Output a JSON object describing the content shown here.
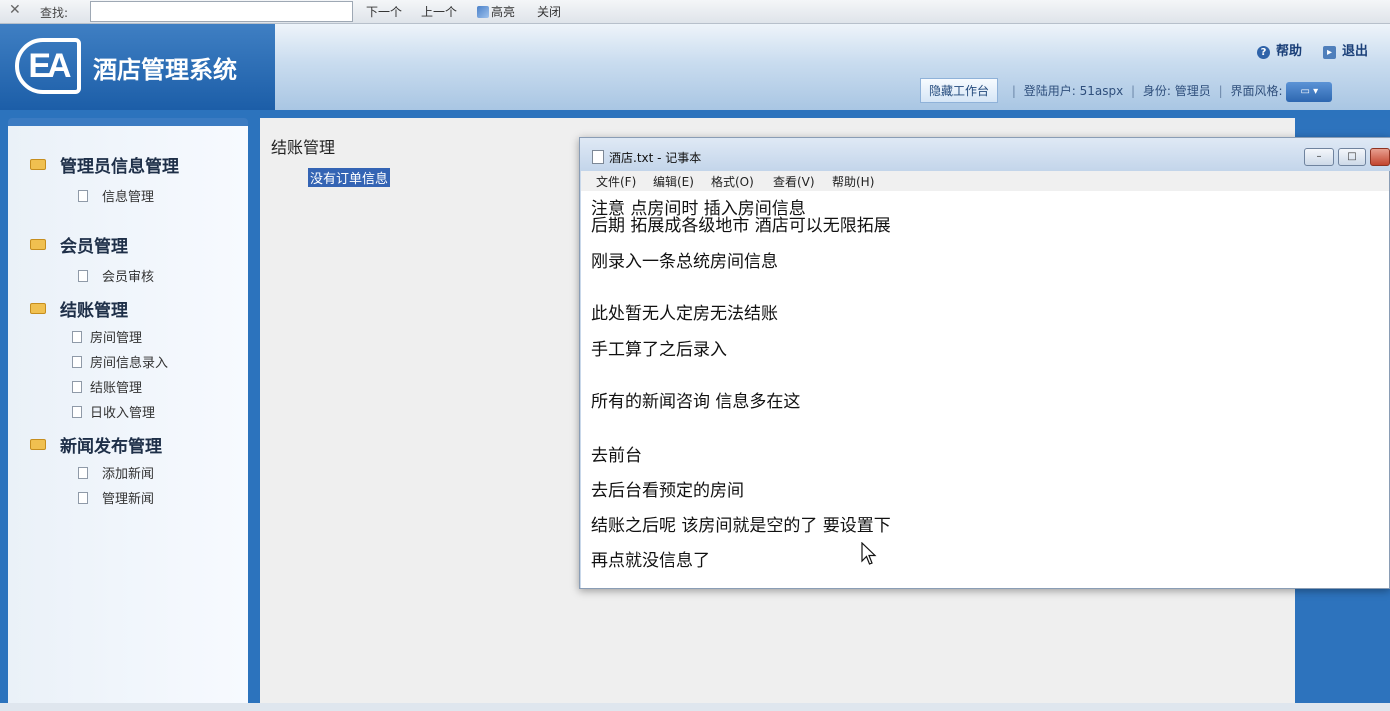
{
  "findbar": {
    "close": "✕",
    "label": "查找:",
    "input_value": "",
    "next": "下一个",
    "prev": "上一个",
    "highlight": "高亮",
    "close_label": "关闭"
  },
  "header": {
    "logo_text": "EA",
    "app_title": "酒店管理系统",
    "help": "帮助",
    "logout": "退出",
    "hide_workbench": "隐藏工作台",
    "login_user": "登陆用户: 51aspx",
    "role": "身份: 管理员",
    "theme_label": "界面风格:"
  },
  "sidebar": {
    "groups": [
      {
        "title": "管理员信息管理",
        "items": [
          "信息管理"
        ]
      },
      {
        "title": "会员管理",
        "items": [
          "会员审核"
        ]
      },
      {
        "title": "结账管理",
        "items": [
          "房间管理",
          "房间信息录入",
          "结账管理",
          "日收入管理"
        ]
      },
      {
        "title": "新闻发布管理",
        "items": [
          "添加新闻",
          "管理新闻"
        ]
      }
    ]
  },
  "main": {
    "heading": "结账管理",
    "no_order": "没有订单信息"
  },
  "notepad": {
    "title": "酒店.txt - 记事本",
    "menu": [
      "文件(F)",
      "编辑(E)",
      "格式(O)",
      "查看(V)",
      "帮助(H)"
    ],
    "lines": [
      "注意  点房间时  插入房间信息",
      "后期  拓展成各级地市  酒店可以无限拓展",
      "刚录入一条总统房间信息",
      "此处暂无人定房无法结账",
      "手工算了之后录入",
      "所有的新闻咨询  信息多在这",
      "去前台",
      "去后台看预定的房间",
      "结账之后呢  该房间就是空的了  要设置下",
      "再点就没信息了"
    ]
  },
  "colors": {
    "brand_blue": "#2c73bd",
    "selection": "#3464b4",
    "folder": "#f0c050"
  }
}
